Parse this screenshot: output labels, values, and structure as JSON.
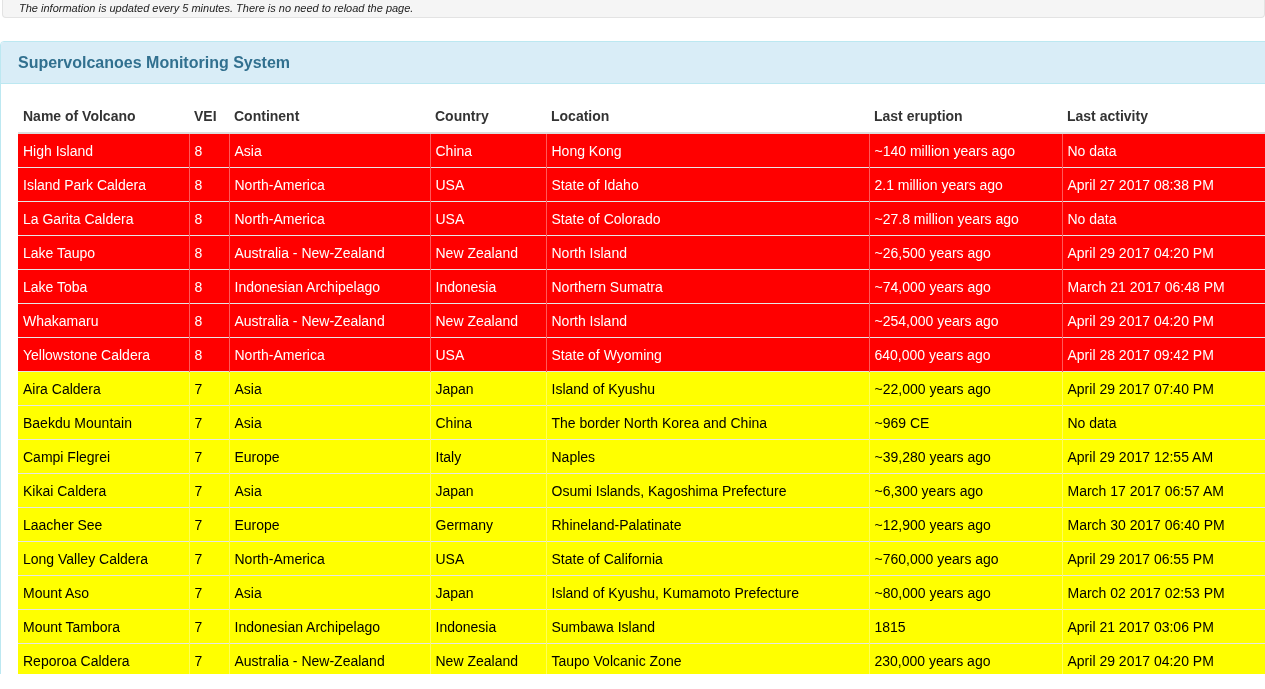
{
  "notice": {
    "text": "The information is updated every 5 minutes. There is no need to reload the page."
  },
  "panel": {
    "title": "Supervolcanoes Monitoring System"
  },
  "table": {
    "columns": [
      "Name of Volcano",
      "VEI",
      "Continent",
      "Country",
      "Location",
      "Last eruption",
      "Last activity"
    ],
    "rows": [
      {
        "color": "#ff0000",
        "cells": [
          "High Island",
          "8",
          "Asia",
          "China",
          "Hong Kong",
          "~140 million years ago",
          "No data"
        ]
      },
      {
        "color": "#ff0000",
        "cells": [
          "Island Park Caldera",
          "8",
          "North-America",
          "USA",
          "State of Idaho",
          "2.1 million years ago",
          "April 27 2017 08:38 PM"
        ]
      },
      {
        "color": "#ff0000",
        "cells": [
          "La Garita Caldera",
          "8",
          "North-America",
          "USA",
          "State of Colorado",
          "~27.8 million years ago",
          "No data"
        ]
      },
      {
        "color": "#ff0000",
        "cells": [
          "Lake Taupo",
          "8",
          "Australia - New-Zealand",
          "New Zealand",
          "North Island",
          "~26,500 years ago",
          "April 29 2017 04:20 PM"
        ]
      },
      {
        "color": "#ff0000",
        "cells": [
          "Lake Toba",
          "8",
          "Indonesian Archipelago",
          "Indonesia",
          "Northern Sumatra",
          "~74,000 years ago",
          "March 21 2017 06:48 PM"
        ]
      },
      {
        "color": "#ff0000",
        "cells": [
          "Whakamaru",
          "8",
          "Australia - New-Zealand",
          "New Zealand",
          "North Island",
          "~254,000 years ago",
          "April 29 2017 04:20 PM"
        ]
      },
      {
        "color": "#ff0000",
        "cells": [
          "Yellowstone Caldera",
          "8",
          "North-America",
          "USA",
          "State of Wyoming",
          "640,000 years ago",
          "April 28 2017 09:42 PM"
        ]
      },
      {
        "color": "#ffff00",
        "cells": [
          "Aira Caldera",
          "7",
          "Asia",
          "Japan",
          "Island of Kyushu",
          "~22,000 years ago",
          "April 29 2017 07:40 PM"
        ]
      },
      {
        "color": "#ffff00",
        "cells": [
          "Baekdu Mountain",
          "7",
          "Asia",
          "China",
          "The border North Korea and China",
          "~969 CE",
          "No data"
        ]
      },
      {
        "color": "#ffff00",
        "cells": [
          "Campi Flegrei",
          "7",
          "Europe",
          "Italy",
          "Naples",
          "~39,280 years ago",
          "April 29 2017 12:55 AM"
        ]
      },
      {
        "color": "#ffff00",
        "cells": [
          "Kikai Caldera",
          "7",
          "Asia",
          "Japan",
          "Osumi Islands, Kagoshima Prefecture",
          "~6,300 years ago",
          "March 17 2017 06:57 AM"
        ]
      },
      {
        "color": "#ffff00",
        "cells": [
          "Laacher See",
          "7",
          "Europe",
          "Germany",
          "Rhineland-Palatinate",
          "~12,900 years ago",
          "March 30 2017 06:40 PM"
        ]
      },
      {
        "color": "#ffff00",
        "cells": [
          "Long Valley Caldera",
          "7",
          "North-America",
          "USA",
          "State of California",
          "~760,000 years ago",
          "April 29 2017 06:55 PM"
        ]
      },
      {
        "color": "#ffff00",
        "cells": [
          "Mount Aso",
          "7",
          "Asia",
          "Japan",
          "Island of Kyushu, Kumamoto Prefecture",
          "~80,000 years ago",
          "March 02 2017 02:53 PM"
        ]
      },
      {
        "color": "#ffff00",
        "cells": [
          "Mount Tambora",
          "7",
          "Indonesian Archipelago",
          "Indonesia",
          "Sumbawa Island",
          "1815",
          "April 21 2017 03:06 PM"
        ]
      },
      {
        "color": "#ffff00",
        "cells": [
          "Reporoa Caldera",
          "7",
          "Australia - New-Zealand",
          "New Zealand",
          "Taupo Volcanic Zone",
          "230,000 years ago",
          "April 29 2017 04:20 PM"
        ]
      }
    ]
  }
}
